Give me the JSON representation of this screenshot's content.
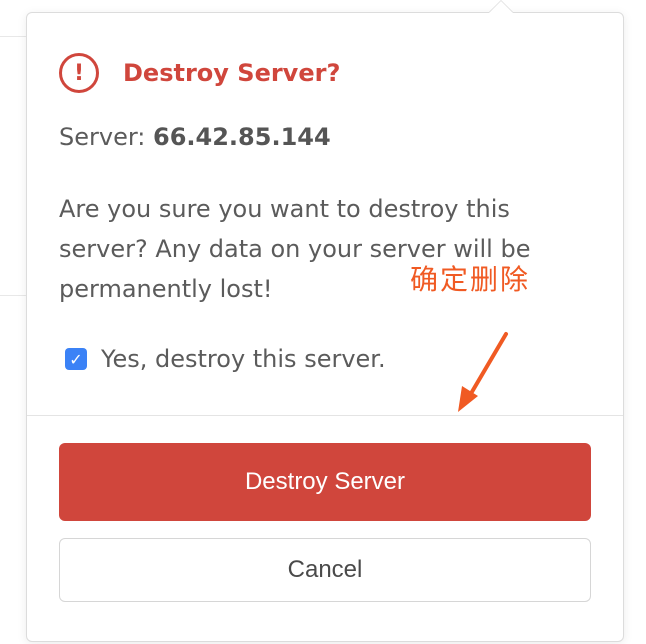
{
  "dialog": {
    "title": "Destroy Server?",
    "icon": "exclamation-circle-icon",
    "server_label": "Server:",
    "server_ip": "66.42.85.144",
    "message": "Are you sure you want to destroy this server? Any data on your server will be permanently lost!",
    "confirm_checkbox": {
      "label": "Yes, destroy this server.",
      "checked": true
    },
    "destroy_button_label": "Destroy Server",
    "cancel_button_label": "Cancel"
  },
  "annotation": {
    "text": "确定删除",
    "color": "#f05a23"
  },
  "colors": {
    "danger": "#d0463c",
    "checkbox": "#3b82f6",
    "text": "#5b5b5b"
  }
}
